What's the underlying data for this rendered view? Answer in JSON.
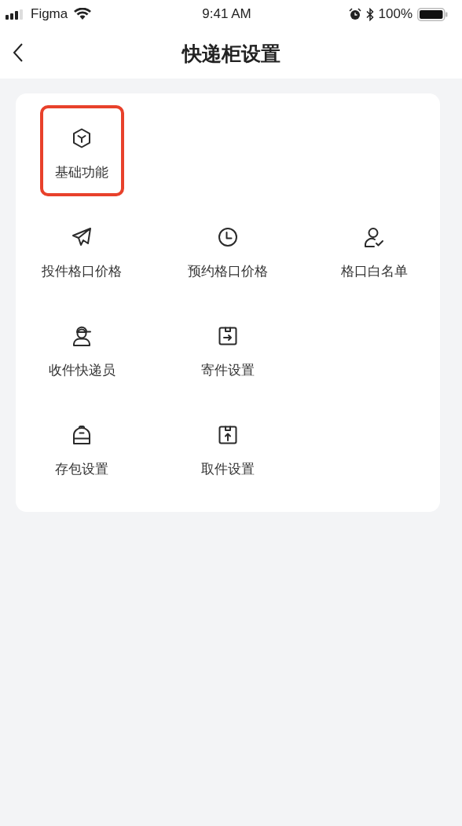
{
  "status_bar": {
    "carrier": "Figma",
    "time": "9:41 AM",
    "battery": "100%"
  },
  "nav": {
    "title": "快递柜设置"
  },
  "grid": {
    "rows": [
      {
        "items": [
          {
            "label": "基础功能",
            "selected": true
          }
        ]
      },
      {
        "items": [
          {
            "label": "投件格口价格",
            "selected": false
          },
          {
            "label": "预约格口价格",
            "selected": false
          },
          {
            "label": "格口白名单",
            "selected": false
          }
        ]
      },
      {
        "items": [
          {
            "label": "收件快递员",
            "selected": false
          },
          {
            "label": "寄件设置",
            "selected": false
          }
        ]
      },
      {
        "items": [
          {
            "label": "存包设置",
            "selected": false
          },
          {
            "label": "取件设置",
            "selected": false
          }
        ]
      }
    ]
  }
}
